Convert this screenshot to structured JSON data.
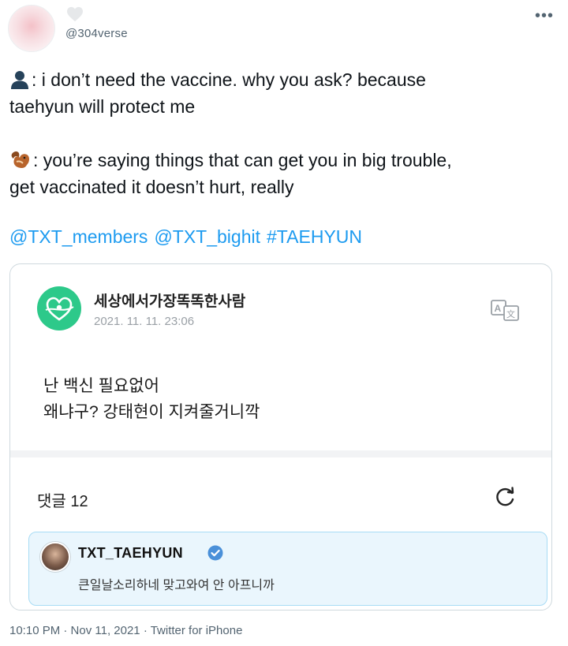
{
  "header": {
    "handle": "@304verse",
    "more_icon": "more-dots-icon"
  },
  "tweet": {
    "line1_text": ": i don’t need the vaccine. why you ask? because",
    "line2_text": "taehyun will protect me",
    "line3_text": ": you’re saying things that can get you in big trouble,",
    "line4_text": "get vaccinated it doesn’t hurt, really",
    "mentions": [
      "@TXT_members",
      "@TXT_bighit",
      "#TAEHYUN"
    ],
    "link_color": "#1d9bf0"
  },
  "card": {
    "author": "세상에서가장똑똑한사람",
    "date": "2021. 11. 11. 23:06",
    "body_line1": "난 백신 필요없어",
    "body_line2": "왜냐구? 강태현이 지켜줄거니깍",
    "comments_label": "댓글 12",
    "logo_color": "#2dc98a",
    "reply": {
      "name": "TXT_TAEHYUN",
      "text": "큰일날소리하네 맞고와여 안 아프니까",
      "highlight_color": "#eaf6fd"
    }
  },
  "footer": {
    "meta": "10:10 PM · Nov 11, 2021 · Twitter for iPhone"
  }
}
